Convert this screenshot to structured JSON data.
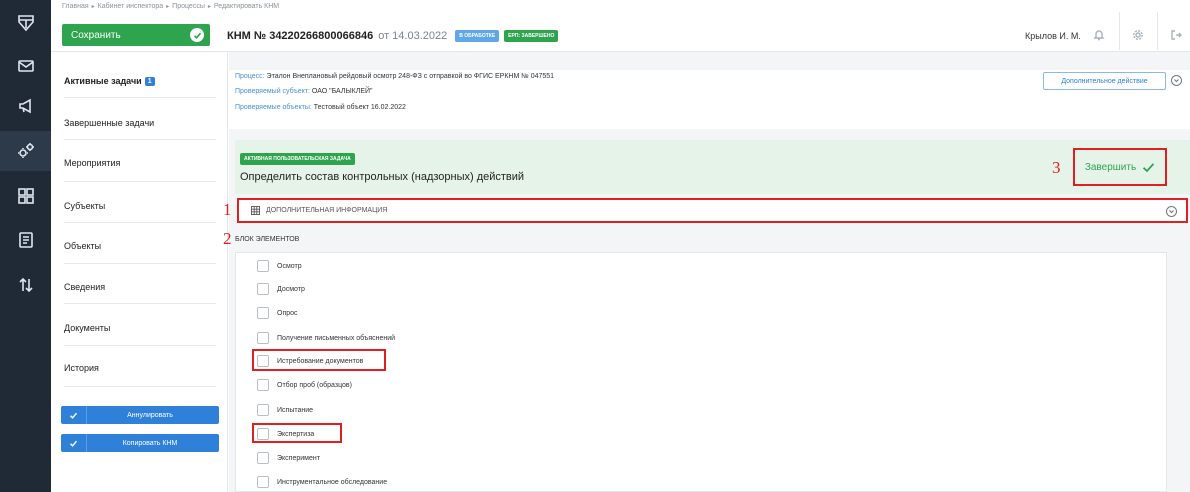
{
  "breadcrumb": [
    "Главная",
    "Кабинет инспектора",
    "Процессы",
    "Редактировать КНМ"
  ],
  "toolbar": {
    "save_label": "Сохранить"
  },
  "record": {
    "number": "КНМ № 34220266800066846",
    "date": "от 14.03.2022",
    "status_badge": "В ОБРАБОТКЕ",
    "erp_badge": "ЕРП: ЗАВЕРШЕНО"
  },
  "user": {
    "name": "Крылов И. М."
  },
  "sidebar": {
    "items": [
      {
        "label": "Активные задачи",
        "badge": "1"
      },
      {
        "label": "Завершенные задачи"
      },
      {
        "label": "Мероприятия"
      },
      {
        "label": "Субъекты"
      },
      {
        "label": "Объекты"
      },
      {
        "label": "Сведения"
      },
      {
        "label": "Документы"
      },
      {
        "label": "История"
      }
    ],
    "annul_label": "Аннулировать",
    "copy_label": "Копировать КНМ"
  },
  "process_info": {
    "process_key": "Процесс:",
    "process_value": "Эталон Внеплановый рейдовый осмотр 248-ФЗ с отправкой во ФГИС ЕРКНМ № 047551",
    "subject_key": "Проверяемый субъект:",
    "subject_value": "ОАО \"БАЛЫКЛЕЙ\"",
    "objects_key": "Проверяемые объекты:",
    "objects_value": "Тестовый объект 16.02.2022",
    "more_action_label": "Дополнительное действие"
  },
  "task": {
    "badge": "АКТИВНАЯ ПОЛЬЗОВАТЕЛЬСКАЯ ЗАДАЧА",
    "title": "Определить состав контрольных (надзорных) действий",
    "finish_label": "Завершить"
  },
  "annotations": {
    "n1": "1",
    "n2": "2",
    "n3": "3"
  },
  "additional_info": {
    "label": "ДОПОЛНИТЕЛЬНАЯ ИНФОРМАЦИЯ"
  },
  "block": {
    "title": "БЛОК ЭЛЕМЕНТОВ",
    "items": [
      "Осмотр",
      "Досмотр",
      "Опрос",
      "Получение письменных объяснений",
      "Истребование документов",
      "Отбор проб (образцов)",
      "Испытание",
      "Экспертиза",
      "Эксперимент",
      "Инструментальное обследование"
    ]
  },
  "colors": {
    "accent_green": "#2ea44f",
    "accent_blue": "#2f80d9",
    "annotation_red": "#e02020",
    "rail": "#1f2a36"
  }
}
